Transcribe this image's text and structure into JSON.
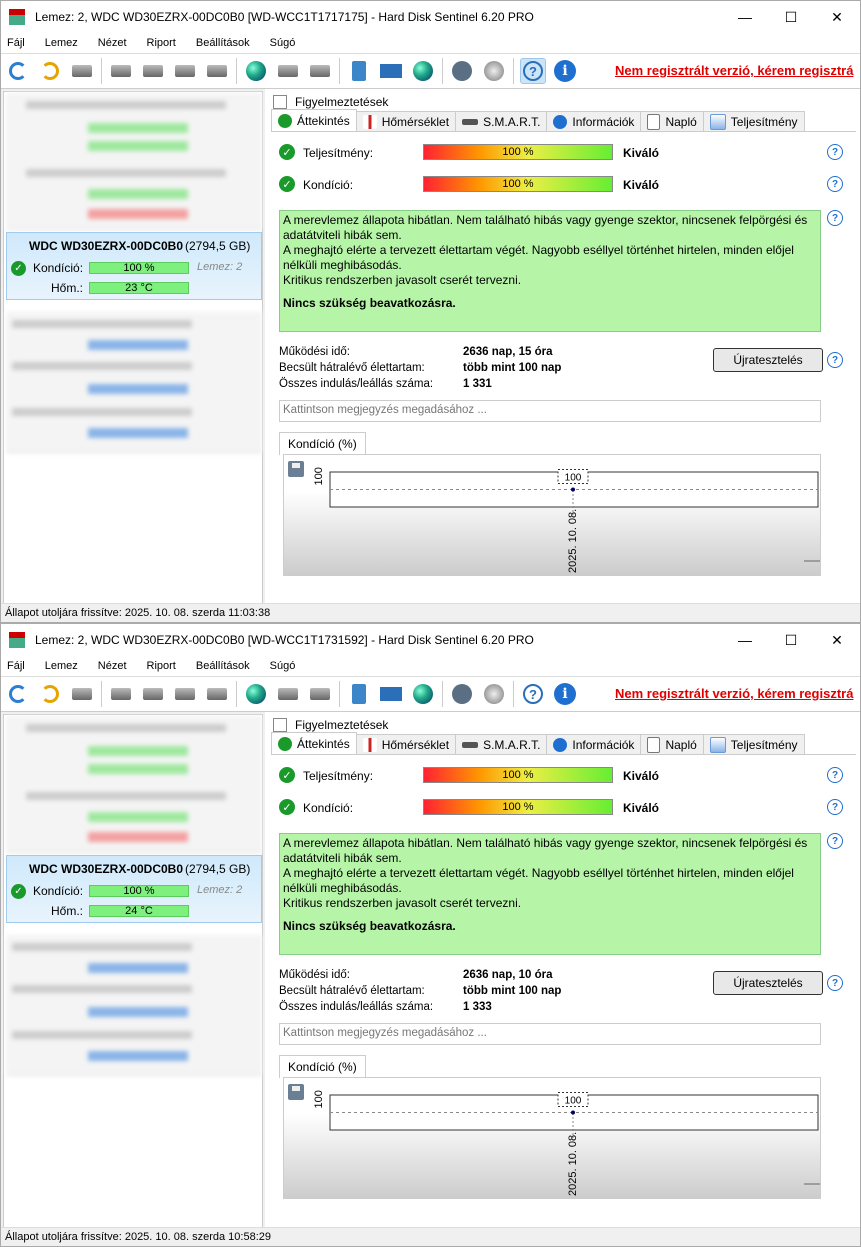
{
  "windows": [
    {
      "title": "Lemez: 2, WDC WD30EZRX-00DC0B0 [WD-WCC1T1717175]  -  Hard Disk Sentinel 6.20 PRO",
      "menu": [
        "Fájl",
        "Lemez",
        "Nézet",
        "Riport",
        "Beállítások",
        "Súgó"
      ],
      "unregistered": "Nem regisztrált verzió, kérem regisztrá",
      "selected_disk": {
        "name": "WDC WD30EZRX-00DC0B0",
        "size": "(2794,5 GB)",
        "condition_label": "Kondíció:",
        "condition_value": "100 %",
        "temp_label": "Hőm.:",
        "temp_value": "23 °C",
        "disk_label": "Lemez: 2"
      },
      "warnings_tab": "Figyelmeztetések",
      "tabs": [
        "Áttekintés",
        "Hőmérséklet",
        "S.M.A.R.T.",
        "Információk",
        "Napló",
        "Teljesítmény"
      ],
      "performance": {
        "label": "Teljesítmény:",
        "value": "100 %",
        "rating": "Kiváló"
      },
      "condition": {
        "label": "Kondíció:",
        "value": "100 %",
        "rating": "Kiváló"
      },
      "message": {
        "line1": "A merevlemez állapota hibátlan. Nem található hibás vagy gyenge szektor, nincsenek felpörgési és adatátviteli hibák sem.",
        "line2": "A meghajtó elérte a tervezett élettartam végét. Nagyobb eséllyel történhet hirtelen, minden előjel nélküli meghibásodás.",
        "line3": "Kritikus rendszerben javasolt cserét tervezni.",
        "action": "Nincs szükség beavatkozásra."
      },
      "info": {
        "uptime_label": "Működési idő:",
        "uptime_value": "2636 nap, 15 óra",
        "remaining_label": "Becsült hátralévő élettartam:",
        "remaining_value": "több mint 100 nap",
        "starts_label": "Összes indulás/leállás száma:",
        "starts_value": "1 331"
      },
      "retest_button": "Újratesztelés",
      "note_placeholder": "Kattintson megjegyzés megadásához ...",
      "chart_tab": "Kondíció  (%)",
      "status": "Állapot utoljára frissítve: 2025. 10. 08. szerda 11:03:38"
    },
    {
      "title": "Lemez: 2, WDC WD30EZRX-00DC0B0 [WD-WCC1T1731592]  -  Hard Disk Sentinel 6.20 PRO",
      "menu": [
        "Fájl",
        "Lemez",
        "Nézet",
        "Riport",
        "Beállítások",
        "Súgó"
      ],
      "unregistered": "Nem regisztrált verzió, kérem regisztrá",
      "selected_disk": {
        "name": "WDC WD30EZRX-00DC0B0",
        "size": "(2794,5 GB)",
        "condition_label": "Kondíció:",
        "condition_value": "100 %",
        "temp_label": "Hőm.:",
        "temp_value": "24 °C",
        "disk_label": "Lemez: 2"
      },
      "warnings_tab": "Figyelmeztetések",
      "tabs": [
        "Áttekintés",
        "Hőmérséklet",
        "S.M.A.R.T.",
        "Információk",
        "Napló",
        "Teljesítmény"
      ],
      "performance": {
        "label": "Teljesítmény:",
        "value": "100 %",
        "rating": "Kiváló"
      },
      "condition": {
        "label": "Kondíció:",
        "value": "100 %",
        "rating": "Kiváló"
      },
      "message": {
        "line1": "A merevlemez állapota hibátlan. Nem található hibás vagy gyenge szektor, nincsenek felpörgési és adatátviteli hibák sem.",
        "line2": "A meghajtó elérte a tervezett élettartam végét. Nagyobb eséllyel történhet hirtelen, minden előjel nélküli meghibásodás.",
        "line3": "Kritikus rendszerben javasolt cserét tervezni.",
        "action": "Nincs szükség beavatkozásra."
      },
      "info": {
        "uptime_label": "Működési idő:",
        "uptime_value": "2636 nap, 10 óra",
        "remaining_label": "Becsült hátralévő élettartam:",
        "remaining_value": "több mint 100 nap",
        "starts_label": "Összes indulás/leállás száma:",
        "starts_value": "1 333"
      },
      "retest_button": "Újratesztelés",
      "note_placeholder": "Kattintson megjegyzés megadásához ...",
      "chart_tab": "Kondíció  (%)",
      "status": "Állapot utoljára frissítve: 2025. 10. 08. szerda 10:58:29"
    }
  ],
  "chart_data": [
    {
      "type": "line",
      "x": [
        "2025. 10. 08."
      ],
      "y": [
        100
      ],
      "ytick": "100",
      "point_label": "100"
    },
    {
      "type": "line",
      "x": [
        "2025. 10. 08."
      ],
      "y": [
        100
      ],
      "ytick": "100",
      "point_label": "100"
    }
  ],
  "colors": {
    "unregistered": "#e00000",
    "message_bg": "#b6f5a8",
    "ok_green": "#1a9a2a"
  }
}
